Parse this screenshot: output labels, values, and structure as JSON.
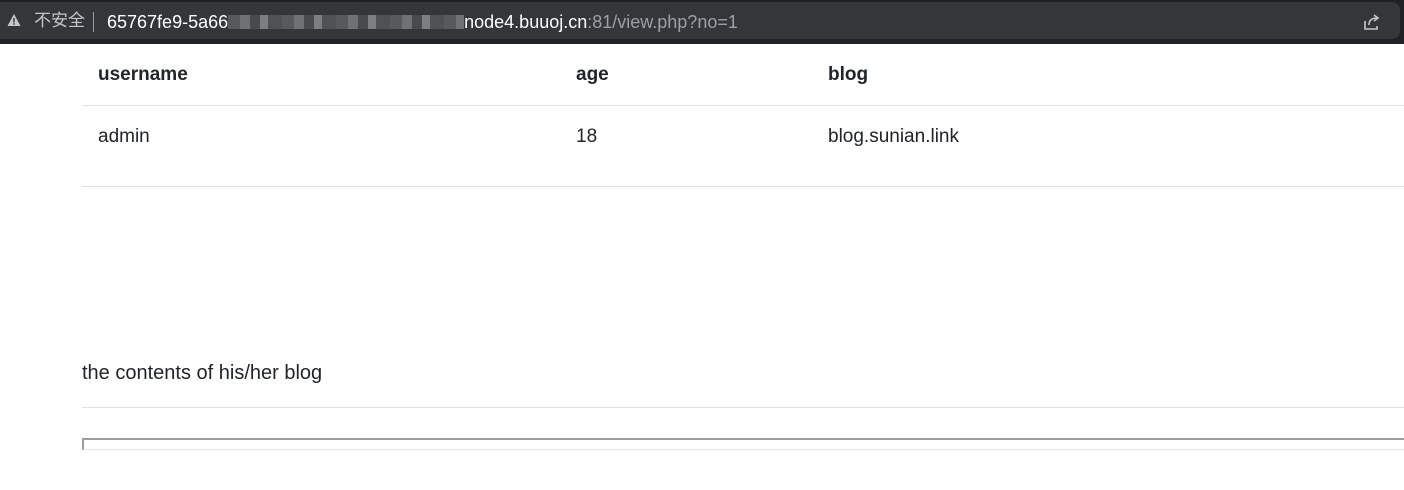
{
  "browser": {
    "security_label": "不安全",
    "url_host_start": "65767fe9-5a66",
    "url_host_end": "node4.buuoj.cn",
    "url_path": ":81/view.php?no=1",
    "icons": [
      "warning-triangle-icon",
      "share-icon"
    ]
  },
  "table": {
    "headers": [
      "username",
      "age",
      "blog"
    ],
    "rows": [
      {
        "username": "admin",
        "age": "18",
        "blog": "blog.sunian.link"
      }
    ]
  },
  "blog_section": {
    "text": "the contents of his/her blog"
  }
}
